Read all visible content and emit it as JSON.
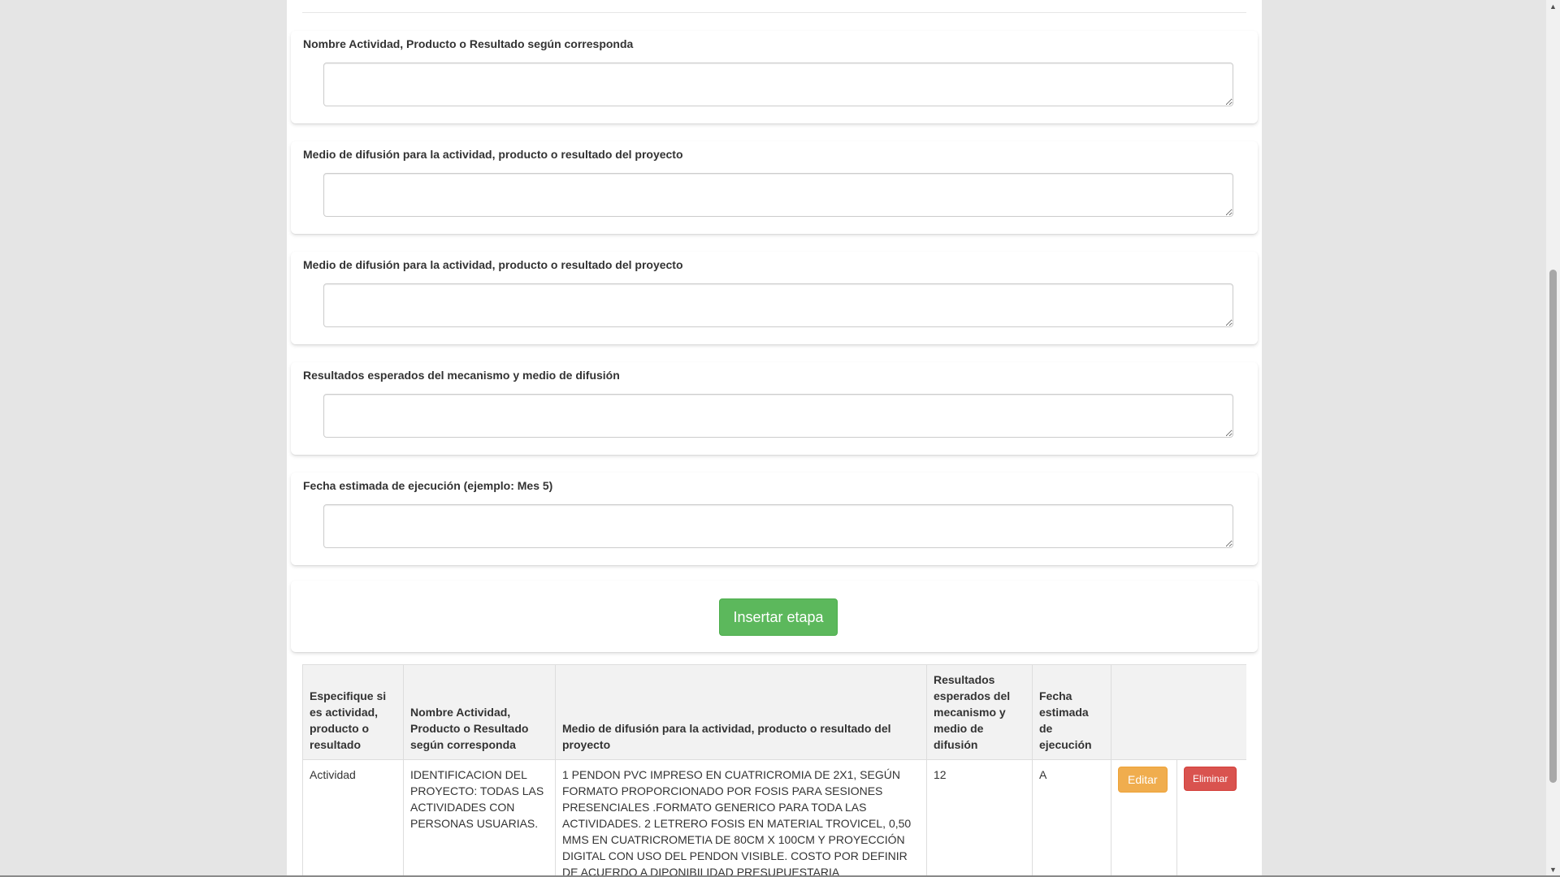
{
  "form": {
    "fields": [
      {
        "label": "Nombre Actividad, Producto o Resultado según corresponda",
        "value": ""
      },
      {
        "label": "Medio de difusión para la actividad, producto o resultado del proyecto",
        "value": ""
      },
      {
        "label": "Medio de difusión para la actividad, producto o resultado del proyecto",
        "value": ""
      },
      {
        "label": "Resultados esperados del mecanismo y medio de difusión",
        "value": ""
      },
      {
        "label": "Fecha estimada de ejecución (ejemplo: Mes 5)",
        "value": ""
      }
    ],
    "submit_label": "Insertar etapa"
  },
  "table": {
    "headers": [
      "Especifique si es actividad, producto o resultado",
      "Nombre Actividad, Producto o Resultado según corresponda",
      "Medio de difusión para la actividad, producto o resultado del proyecto",
      "Resultados esperados del mecanismo y medio de difusión",
      "Fecha estimada de ejecución"
    ],
    "rows": [
      {
        "tipo": "Actividad",
        "nombre": "IDENTIFICACION DEL PROYECTO: TODAS LAS ACTIVIDADES CON PERSONAS USUARIAS.",
        "medio": "1 PENDON PVC IMPRESO EN CUATRICROMIA DE 2X1, SEGÚN FORMATO PROPORCIONADO POR FOSIS PARA SESIONES PRESENCIALES .FORMATO GENERICO PARA TODA LAS ACTIVIDADES. 2 LETRERO FOSIS EN MATERIAL TROVICEL, 0,50 MMS EN CUATRICROMETIA DE 80CM X 100CM Y PROYECCIÓN DIGITAL CON USO DEL PENDON VISIBLE. COSTO POR DEFINIR DE ACUERDO A DIPONIBILIDAD PRESUPUESTARIA",
        "resultados": "12",
        "fecha": "A",
        "edit_label": "Editar",
        "delete_label": "Eliminar"
      }
    ]
  },
  "scrollbar": {
    "up_arrow": "▲",
    "down_arrow": "▼"
  }
}
